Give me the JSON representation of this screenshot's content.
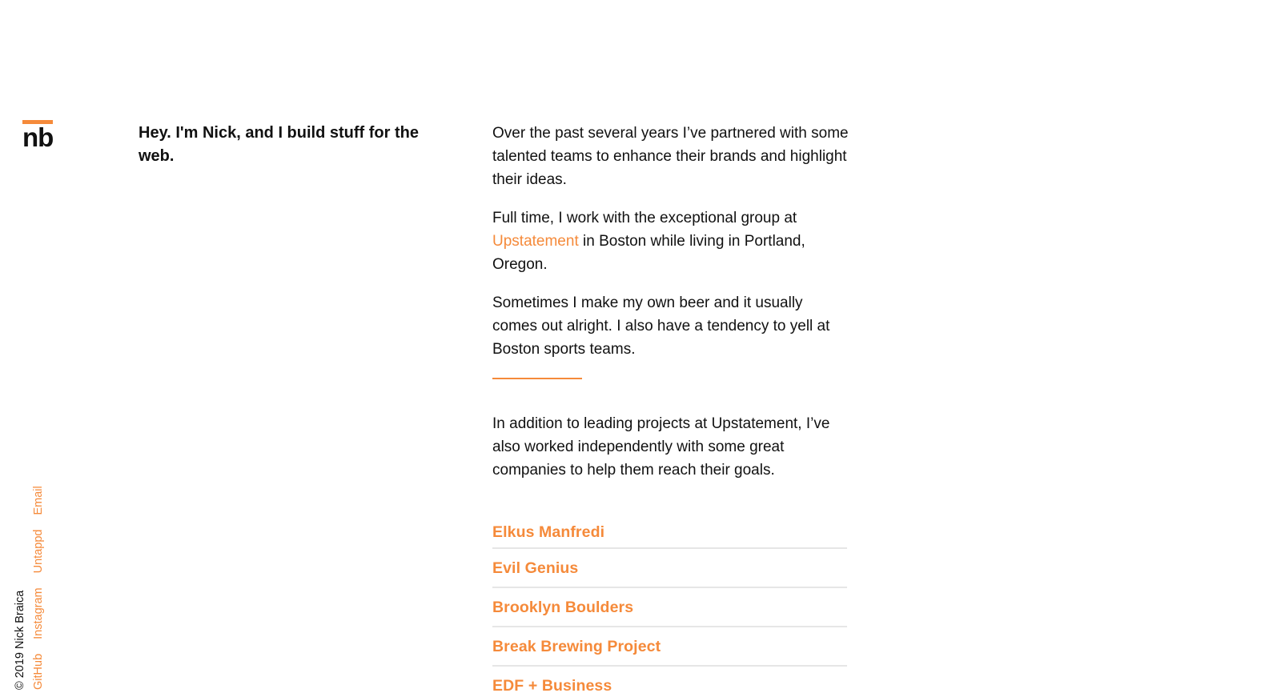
{
  "logo": {
    "text": "nb",
    "accent_color": "#f58a3a"
  },
  "sidebar": {
    "copyright": "© 2019 Nick Braica",
    "links": [
      "GitHub",
      "Instagram",
      "Untappd",
      "Email"
    ]
  },
  "intro": {
    "heading": "Hey. I'm Nick, and I build stuff for the web."
  },
  "main": {
    "p1": "Over the past several years I’ve partnered with some talented teams to enhance their brands and highlight their ideas.",
    "p2_before": "Full time, I work with the exceptional group at ",
    "p2_link": "Upstatement",
    "p2_after": " in Boston while living in Portland, Oregon.",
    "p3": "Sometimes I make my own beer and it usually comes out alright. I also have a tendency to yell at Boston sports teams.",
    "p4": "In addition to leading projects at Upstatement, I’ve also worked independently with some great companies to help them reach their goals."
  },
  "clients": [
    "Elkus Manfredi",
    "Evil Genius",
    "Brooklyn Boulders",
    "Break Brewing Project",
    "EDF + Business"
  ],
  "colors": {
    "accent": "#f58a3a",
    "text": "#111111",
    "rule": "#e6e6e6"
  }
}
